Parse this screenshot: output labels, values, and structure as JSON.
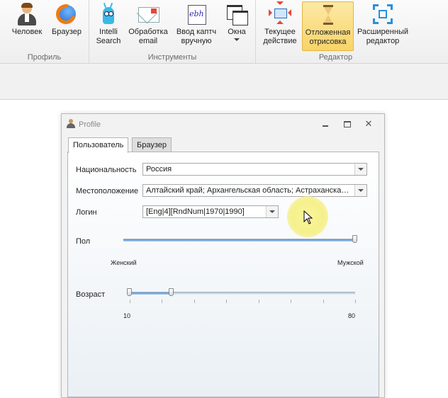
{
  "ribbon": {
    "groups": [
      {
        "label": "Профиль"
      },
      {
        "label": "Инструменты"
      },
      {
        "label": "Редактор"
      }
    ],
    "buttons": {
      "person": "Человек",
      "browser": "Браузер",
      "intelli_1": "Intelli",
      "intelli_2": "Search",
      "email_1": "Обработка",
      "email_2": "email",
      "captcha_1": "Ввод каптч",
      "captcha_2": "вручную",
      "captcha_icon_text": "ebh",
      "windows": "Окна",
      "current_1": "Текущее",
      "current_2": "действие",
      "deferred_1": "Отложенная",
      "deferred_2": "отрисовка",
      "advanced_1": "Расширенный",
      "advanced_2": "редактор"
    }
  },
  "dialog": {
    "title": "Profile",
    "close_glyph": "✕",
    "tabs": [
      "Пользователь",
      "Браузер"
    ],
    "fields": {
      "nationality_label": "Национальность",
      "nationality_value": "Россия",
      "location_label": "Местоположение",
      "location_value": "Алтайский край; Архангельская область; Астраханская область",
      "login_label": "Логин",
      "login_value": "[Eng|4][RndNum|1970|1990]",
      "gender_label": "Пол",
      "gender_left": "Женский",
      "gender_right": "Мужской",
      "gender_level": 1.0,
      "age_label": "Возраст",
      "age_min": "10",
      "age_max": "80",
      "age_range": [
        10,
        23
      ]
    }
  },
  "colors": {
    "active_button": "#f8d468",
    "cursor_highlight": "#f5ee78"
  }
}
